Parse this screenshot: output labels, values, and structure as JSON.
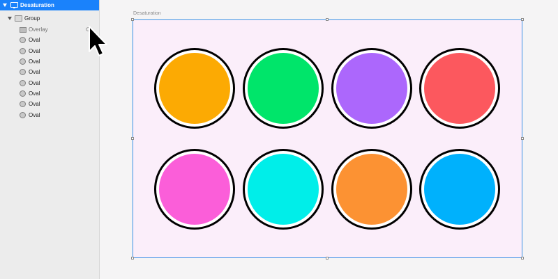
{
  "layers": {
    "artboard": {
      "label": "Desaturation",
      "icon": "artboard-icon"
    },
    "group": {
      "label": "Group",
      "icon": "folder-icon"
    },
    "items": [
      {
        "label": "Overlay",
        "icon": "rectangle-icon",
        "extra_icon": "eye-icon"
      },
      {
        "label": "Oval",
        "icon": "oval-icon"
      },
      {
        "label": "Oval",
        "icon": "oval-icon"
      },
      {
        "label": "Oval",
        "icon": "oval-icon"
      },
      {
        "label": "Oval",
        "icon": "oval-icon"
      },
      {
        "label": "Oval",
        "icon": "oval-icon"
      },
      {
        "label": "Oval",
        "icon": "oval-icon"
      },
      {
        "label": "Oval",
        "icon": "oval-icon"
      },
      {
        "label": "Oval",
        "icon": "oval-icon"
      }
    ]
  },
  "canvas": {
    "artboard_title": "Desaturation",
    "artboard_background": "#fbeefa",
    "selection_color": "#3a8fe6",
    "ovals": [
      {
        "color": "#fcaa03"
      },
      {
        "color": "#00e56a"
      },
      {
        "color": "#ac67fc"
      },
      {
        "color": "#fc585e"
      },
      {
        "color": "#fb5ed9"
      },
      {
        "color": "#00eee9"
      },
      {
        "color": "#fc9233"
      },
      {
        "color": "#00b1fc"
      }
    ]
  },
  "colors": {
    "selected_row": "#1a82fb",
    "sidebar": "#ececec",
    "canvas_bg": "#f5f4f5"
  }
}
